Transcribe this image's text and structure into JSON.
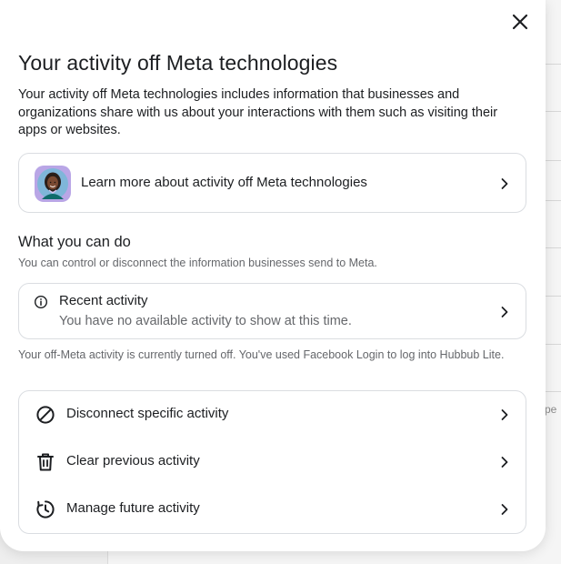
{
  "dialog": {
    "title": "Your activity off Meta technologies",
    "intro": "Your activity off Meta technologies includes information that businesses and organizations share with us about your interactions with them such as visiting their apps or websites.",
    "close_icon": "close-icon"
  },
  "learn_more": {
    "label": "Learn more about activity off Meta technologies",
    "icon": "avatar-illustration"
  },
  "section": {
    "heading": "What you can do",
    "subtitle": "You can control or disconnect the information businesses send to Meta."
  },
  "recent_activity": {
    "title": "Recent activity",
    "description": "You have no available activity to show at this time.",
    "icon": "info-icon"
  },
  "status_note": "Your off-Meta activity is currently turned off. You've used Facebook Login to log into Hubbub Lite.",
  "actions": [
    {
      "label": "Disconnect specific activity",
      "icon": "disconnect-icon"
    },
    {
      "label": "Clear previous activity",
      "icon": "trash-icon"
    },
    {
      "label": "Manage future activity",
      "icon": "clock-history-icon"
    }
  ],
  "background": {
    "peek_text": "pe"
  },
  "colors": {
    "text_primary": "#1c1e21",
    "text_secondary": "#65676b",
    "border": "#dadde1",
    "avatar_bg": "#7fb6d9"
  }
}
